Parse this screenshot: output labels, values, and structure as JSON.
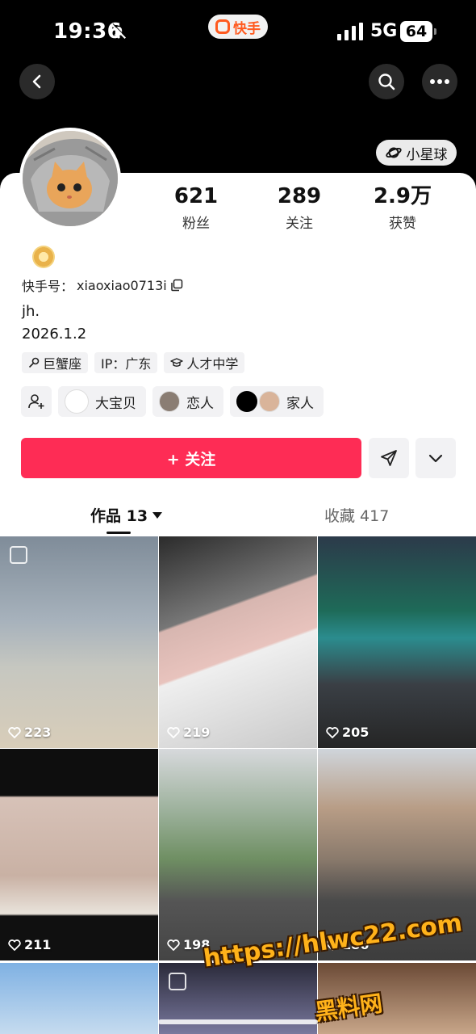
{
  "status_bar": {
    "time": "19:36",
    "app_name": "快手",
    "network": "5G",
    "battery": "64"
  },
  "nav": {
    "back_icon": "chevron-left-icon",
    "search_icon": "search-icon",
    "more_icon": "more-icon"
  },
  "planet_button": {
    "icon": "planet-icon",
    "label": "小星球"
  },
  "stats": [
    {
      "num": "621",
      "label": "粉丝"
    },
    {
      "num": "289",
      "label": "关注"
    },
    {
      "num": "2.9万",
      "label": "获赞"
    }
  ],
  "profile": {
    "kuaishou_id_label": "快手号：",
    "kuaishou_id": "xiaoxiao0713i",
    "bio_line1": "jh.",
    "bio_line2": "2026.1.2"
  },
  "tags": [
    {
      "icon": "zodiac-icon",
      "label": "巨蟹座"
    },
    {
      "icon": "",
      "label": "IP：广东"
    },
    {
      "icon": "graduation-cap-icon",
      "label": "人才中学"
    }
  ],
  "relations": [
    {
      "label": "大宝贝"
    },
    {
      "label": "恋人"
    },
    {
      "label": "家人"
    }
  ],
  "actions": {
    "follow_label": "+ 关注",
    "share_icon": "send-icon",
    "dropdown_icon": "chevron-down-icon"
  },
  "tabs": {
    "works": "作品 13",
    "favorites": "收藏 417"
  },
  "posts": [
    {
      "likes": "223"
    },
    {
      "likes": "219"
    },
    {
      "likes": "205"
    },
    {
      "likes": "211"
    },
    {
      "likes": "198"
    },
    {
      "likes": "186"
    }
  ],
  "watermark": {
    "line1": "https://hlwc22.com",
    "line2": "黑料网"
  },
  "colors": {
    "accent": "#fe2c55",
    "brand": "#ff5a1f"
  }
}
